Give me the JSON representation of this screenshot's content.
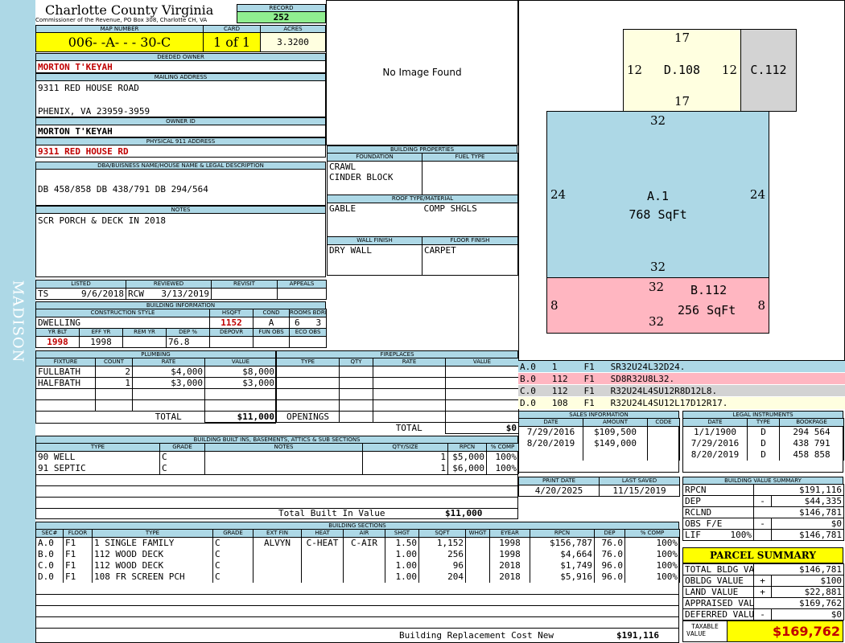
{
  "sidebar": {
    "text": "MADISON"
  },
  "header": {
    "county": "Charlotte County Virginia",
    "commissioner": "Commissioner of the Revenue, PO Box 308, Charlotte CH, VA",
    "record_label": "RECORD",
    "record_value": "252",
    "map_label": "MAP NUMBER",
    "map_value": "006- -A- - - 30-C",
    "card_label": "CARD",
    "card_value": "1 of 1",
    "acres_label": "ACRES",
    "acres_value": "3.3200"
  },
  "owner": {
    "deeded_label": "DEEDED OWNER",
    "deeded_value": "MORTON T'KEYAH",
    "mailing_label": "MAILING ADDRESS",
    "mailing_line1": "9311 RED HOUSE ROAD",
    "mailing_line2": "PHENIX, VA 23959-3959",
    "ownerid_label": "OWNER ID",
    "ownerid_value": "MORTON T'KEYAH",
    "physical_label": "PHYSICAL 911 ADDRESS",
    "physical_value": "9311 RED HOUSE RD"
  },
  "legal": {
    "label": "DBA/BUISNESS NAME/HOUSE NAME & LEGAL DESCRIPTION",
    "value": "DB 458/858 DB 438/791 DB 294/564"
  },
  "notes": {
    "label": "NOTES",
    "value": "SCR PORCH & DECK IN 2018"
  },
  "image": {
    "text": "No Image Found"
  },
  "building_properties": {
    "title": "BUILDING PROPERTIES",
    "foundation_label": "FOUNDATION",
    "fuel_label": "FUEL TYPE",
    "foundation_1": "CRAWL",
    "foundation_2": "CINDER BLOCK",
    "roof_label": "ROOF TYPE/MATERIAL",
    "roof_1": "GABLE",
    "roof_2": "COMP SHGLS",
    "wall_label": "WALL FINISH",
    "floor_label": "FLOOR FINISH",
    "wall_value": "DRY WALL",
    "floor_value": "CARPET"
  },
  "listing": {
    "listed_label": "LISTED",
    "reviewed_label": "REVIEWED",
    "revisit_label": "REVISIT",
    "appeals_label": "APPEALS",
    "listed_by": "TS",
    "listed_date": "9/6/2018",
    "reviewed_by": "RCW",
    "reviewed_date": "3/13/2019"
  },
  "building_info": {
    "title": "BUILDING INFORMATION",
    "style_label": "CONSTRUCTION STYLE",
    "hsqft_label": "HSQFT",
    "cond_label": "COND",
    "rooms_label": "ROOMS",
    "bdrms_label": "BDRMS",
    "style": "DWELLING",
    "hsqft": "1152",
    "cond": "A",
    "rooms": "6",
    "bdrms": "3",
    "yrblt_label": "YR BLT",
    "effyr_label": "EFF YR",
    "remyr_label": "REM YR",
    "dep_label": "DEP %",
    "depovr_label": "DEPOVR",
    "funobs_label": "FUN OBS",
    "ecoobs_label": "ECO OBS",
    "yrblt": "1998",
    "effyr": "1998",
    "dep": "76.8"
  },
  "plumbing": {
    "title": "PLUMBING",
    "headers": [
      "FIXTURE",
      "COUNT",
      "RATE",
      "VALUE"
    ],
    "rows": [
      [
        "FULLBATH",
        "2",
        "$4,000",
        "$8,000"
      ],
      [
        "HALFBATH",
        "1",
        "$3,000",
        "$3,000"
      ]
    ],
    "total_label": "TOTAL",
    "total_value": "$11,000"
  },
  "fireplaces": {
    "title": "FIREPLACES",
    "headers": [
      "TYPE",
      "QTY",
      "RATE",
      "VALUE"
    ],
    "openings_label": "OPENINGS",
    "total_label": "TOTAL",
    "total_value": "$0"
  },
  "builtins": {
    "title": "BUILDING BUILT INS, BASEMENTS, ATTICS & SUB SECTIONS",
    "headers": [
      "TYPE",
      "GRADE",
      "NOTES",
      "QTY/SIZE",
      "RPCN",
      "% COMP"
    ],
    "rows": [
      [
        "90 WELL",
        "C",
        "",
        "1",
        "$5,000",
        "100%"
      ],
      [
        "91 SEPTIC",
        "C",
        "",
        "1",
        "$6,000",
        "100%"
      ]
    ],
    "total_label": "Total Built In Value",
    "total_value": "$11,000"
  },
  "sections": {
    "title": "BUILDING SECTIONS",
    "headers": [
      "SEC#",
      "FLOOR",
      "TYPE",
      "GRADE",
      "EXT FIN",
      "HEAT",
      "AIR",
      "SHGT",
      "SQFT",
      "WHGT",
      "EYEAR",
      "RPCN",
      "DEP",
      "% COMP"
    ],
    "rows": [
      [
        "A.0",
        "F1",
        "1 SINGLE FAMILY",
        "C",
        "ALVYN",
        "C-HEAT",
        "C-AIR",
        "1.50",
        "1,152",
        "",
        "1998",
        "$156,787",
        "76.0",
        "100%"
      ],
      [
        "B.0",
        "F1",
        "112 WOOD DECK",
        "C",
        "",
        "",
        "",
        "1.00",
        "256",
        "",
        "1998",
        "$4,664",
        "76.0",
        "100%"
      ],
      [
        "C.0",
        "F1",
        "112 WOOD DECK",
        "C",
        "",
        "",
        "",
        "1.00",
        "96",
        "",
        "2018",
        "$1,749",
        "96.0",
        "100%"
      ],
      [
        "D.0",
        "F1",
        "108 FR SCREEN PCH",
        "C",
        "",
        "",
        "",
        "1.00",
        "204",
        "",
        "2018",
        "$5,916",
        "96.0",
        "100%"
      ]
    ],
    "total_label": "Building Replacement Cost New",
    "total_value": "$191,116"
  },
  "sketch": {
    "areas": [
      {
        "label": "D.108",
        "top": "17",
        "bottom": "17",
        "left": "12",
        "right": "12"
      },
      {
        "label": "C.112"
      },
      {
        "label": "A.1",
        "sqft": "768 SqFt",
        "top": "32",
        "bottom": "32",
        "left": "24",
        "right": "24"
      },
      {
        "label": "B.112",
        "sqft": "256 SqFt",
        "top": "32",
        "bottom": "32",
        "left": "8",
        "right": "8"
      }
    ]
  },
  "legend": [
    [
      "A.0",
      "1",
      "F1",
      "SR32U24L32D24."
    ],
    [
      "B.0",
      "112",
      "F1",
      "SD8R32U8L32."
    ],
    [
      "C.0",
      "112",
      "F1",
      "R32U24L4SU12R8D12L8."
    ],
    [
      "D.0",
      "108",
      "F1",
      "R32U24L4SU12L17D12R17."
    ]
  ],
  "sales": {
    "title": "SALES INFORMATION",
    "headers": [
      "DATE",
      "AMOUNT",
      "CODE"
    ],
    "rows": [
      [
        "7/29/2016",
        "$109,500",
        ""
      ],
      [
        "8/20/2019",
        "$149,000",
        ""
      ]
    ]
  },
  "instruments": {
    "title": "LEGAL INSTRUMENTS",
    "headers": [
      "DATE",
      "TYPE",
      "BOOKPAGE"
    ],
    "rows": [
      [
        "1/1/1900",
        "D",
        "294 564"
      ],
      [
        "7/29/2016",
        "D",
        "438 791"
      ],
      [
        "8/20/2019",
        "D",
        "458 858"
      ]
    ]
  },
  "print": {
    "print_label": "PRINT DATE",
    "saved_label": "LAST SAVED",
    "print_value": "4/20/2025",
    "saved_value": "11/15/2019"
  },
  "value_summary": {
    "title": "BUILDING VALUE SUMMARY",
    "rows": [
      [
        "RPCN",
        "",
        "$191,116"
      ],
      [
        "DEP",
        "-",
        "$44,335"
      ],
      [
        "RCLND",
        "",
        "$146,781"
      ],
      [
        "OBS F/E",
        "-",
        "$0"
      ],
      [
        "LIF",
        "100%",
        "$146,781"
      ]
    ]
  },
  "parcel": {
    "title": "PARCEL SUMMARY",
    "rows": [
      [
        "TOTAL BLDG VALUE",
        "",
        "$146,781"
      ],
      [
        "OBLDG VALUE",
        "+",
        "$100"
      ],
      [
        "LAND VALUE",
        "+",
        "$22,881"
      ],
      [
        "APPRAISED VALUE",
        "",
        "$169,762"
      ],
      [
        "DEFERRED VALUE",
        "-",
        "$0"
      ]
    ],
    "taxable_label_1": "TAXABLE",
    "taxable_label_2": "VALUE",
    "taxable_value": "$169,762"
  },
  "colors": {
    "header_blue": "#add8e6",
    "yellow": "#ffff00",
    "green": "#90ee90",
    "area_a": "#add8e6",
    "area_b": "#ffb6c1",
    "area_c": "#d3d3d3",
    "area_d": "#ffffe0",
    "red": "#c00000"
  }
}
